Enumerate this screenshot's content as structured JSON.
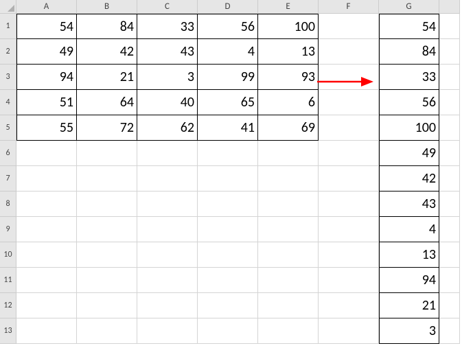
{
  "columns": [
    "A",
    "B",
    "C",
    "D",
    "E",
    "F",
    "G"
  ],
  "rows": [
    "1",
    "2",
    "3",
    "4",
    "5",
    "6",
    "7",
    "8",
    "9",
    "10",
    "11",
    "12",
    "13"
  ],
  "grid": {
    "A1": "54",
    "B1": "84",
    "C1": "33",
    "D1": "56",
    "E1": "100",
    "G1": "54",
    "A2": "49",
    "B2": "42",
    "C2": "43",
    "D2": "4",
    "E2": "13",
    "G2": "84",
    "A3": "94",
    "B3": "21",
    "C3": "3",
    "D3": "99",
    "E3": "93",
    "G3": "33",
    "A4": "51",
    "B4": "64",
    "C4": "40",
    "D4": "65",
    "E4": "6",
    "G4": "56",
    "A5": "55",
    "B5": "72",
    "C5": "62",
    "D5": "41",
    "E5": "69",
    "G5": "100",
    "G6": "49",
    "G7": "42",
    "G8": "43",
    "G9": "4",
    "G10": "13",
    "G11": "94",
    "G12": "21",
    "G13": "3"
  },
  "bordered_ranges": {
    "range1": {
      "cols": [
        "A",
        "B",
        "C",
        "D",
        "E"
      ],
      "rows": [
        1,
        2,
        3,
        4,
        5
      ]
    },
    "range2": {
      "cols": [
        "G"
      ],
      "rows": [
        1,
        2,
        3,
        4,
        5,
        6,
        7,
        8,
        9,
        10,
        11,
        12,
        13
      ]
    }
  }
}
